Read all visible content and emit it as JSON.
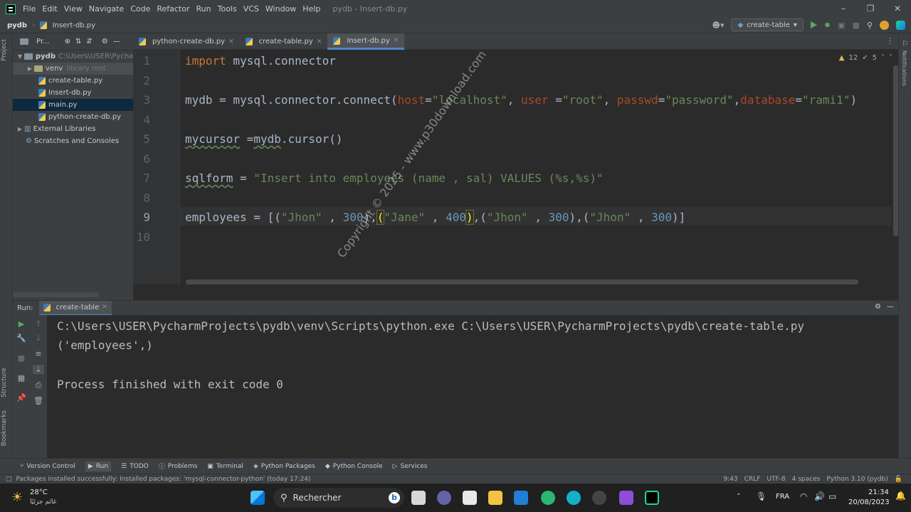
{
  "titlebar": {
    "menu": [
      "File",
      "Edit",
      "View",
      "Navigate",
      "Code",
      "Refactor",
      "Run",
      "Tools",
      "VCS",
      "Window",
      "Help"
    ],
    "title": "pydb - Insert-db.py"
  },
  "navbar": {
    "project": "pydb",
    "file": "Insert-db.py",
    "run_config": "create-table"
  },
  "project_panel": {
    "header": "Pr...",
    "root_name": "pydb",
    "root_path": "C:\\Users\\USER\\Pycharm",
    "venv": "venv",
    "venv_note": "library root",
    "files": [
      "create-table.py",
      "Insert-db.py",
      "main.py",
      "python-create-db.py"
    ],
    "external": "External Libraries",
    "scratches": "Scratches and Consoles"
  },
  "tabs": [
    "python-create-db.py",
    "create-table.py",
    "Insert-db.py"
  ],
  "editor": {
    "line_numbers": [
      "1",
      "2",
      "3",
      "4",
      "5",
      "6",
      "7",
      "8",
      "9",
      "10"
    ],
    "inspections": {
      "warnings": "12",
      "ok": "5"
    }
  },
  "run": {
    "label": "Run:",
    "tab": "create-table",
    "output": [
      "C:\\Users\\USER\\PycharmProjects\\pydb\\venv\\Scripts\\python.exe C:\\Users\\USER\\PycharmProjects\\pydb\\create-table.py",
      "('employees',)",
      "",
      "Process finished with exit code 0"
    ]
  },
  "toolwindows": [
    "Version Control",
    "Run",
    "TODO",
    "Problems",
    "Terminal",
    "Python Packages",
    "Python Console",
    "Services"
  ],
  "statusbar": {
    "message": "Packages installed successfully: Installed packages: 'mysql-connector-python' (today 17:24)",
    "position": "9:43",
    "line_sep": "CRLF",
    "encoding": "UTF-8",
    "indent": "4 spaces",
    "interpreter": "Python 3.10 (pydb)"
  },
  "taskbar": {
    "weather_temp": "28°C",
    "weather_text": "غائم جزئيًا",
    "search": "Rechercher",
    "lang": "FRA",
    "time": "21:34",
    "date": "20/08/2023"
  },
  "watermark": "Copyright © 2025 - www.p30download.com",
  "side_labels": {
    "project": "Project",
    "structure": "Structure",
    "bookmarks": "Bookmarks",
    "notifications": "Notifications"
  }
}
